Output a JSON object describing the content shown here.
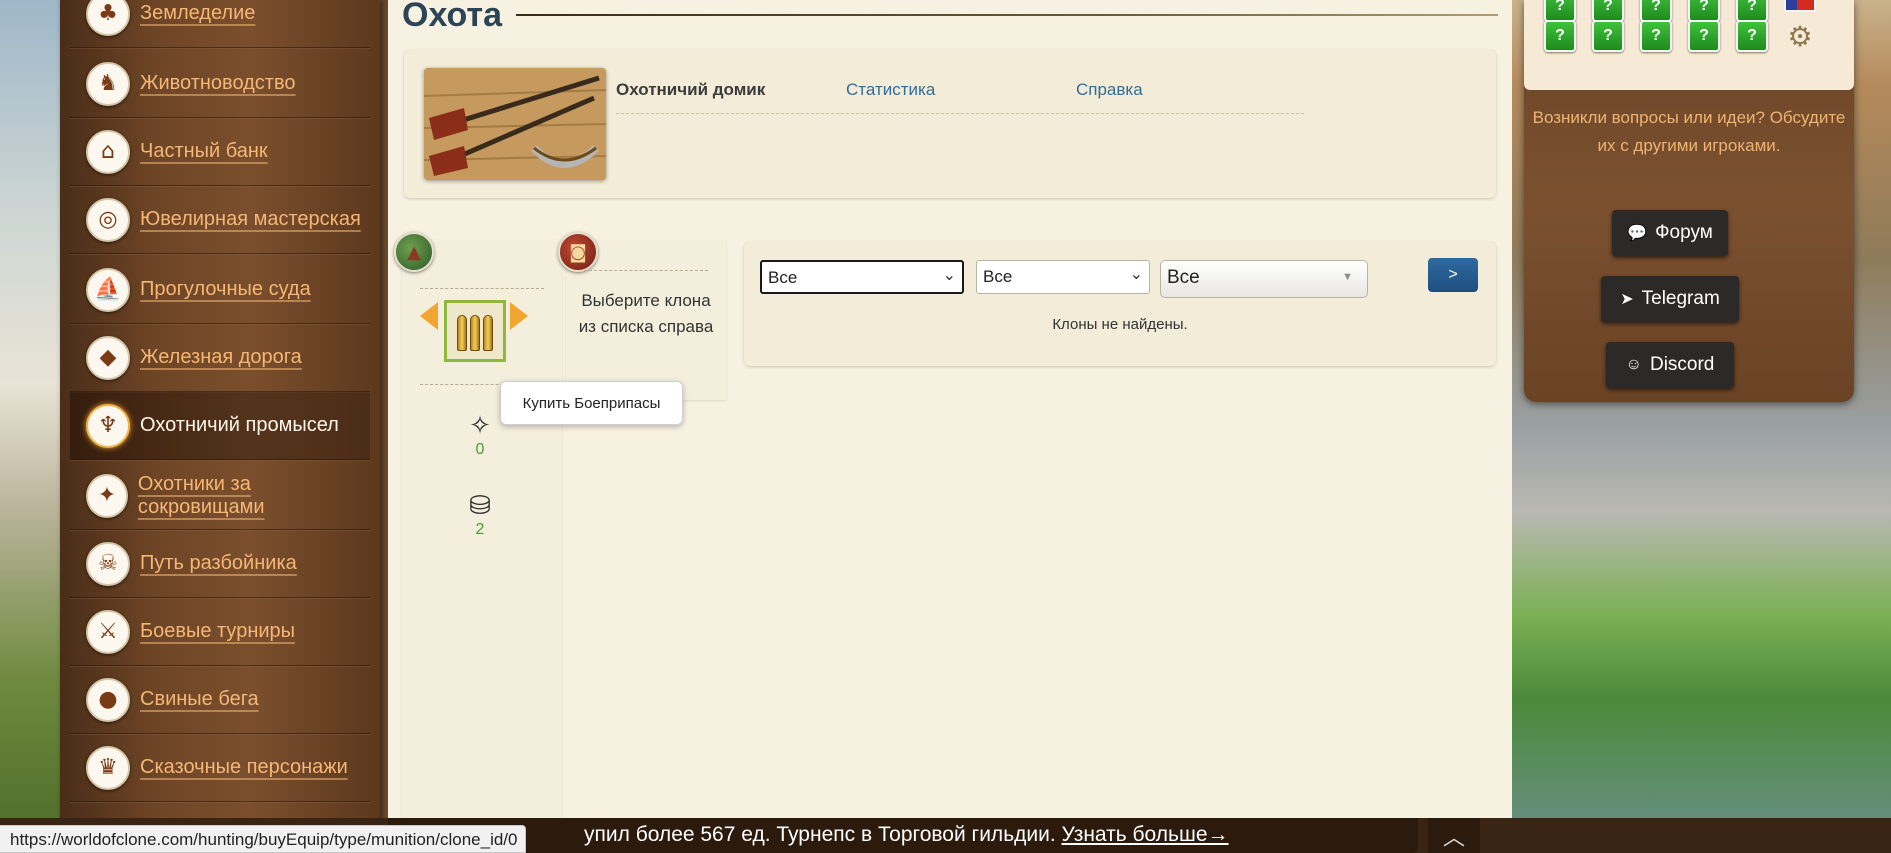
{
  "sidebar": {
    "items": [
      {
        "label": "Земледелие",
        "icon": "farming-icon",
        "glyph": "♣",
        "active": false
      },
      {
        "label": "Животноводство",
        "icon": "livestock-icon",
        "glyph": "♞",
        "active": false
      },
      {
        "label": "Частный банк",
        "icon": "bank-icon",
        "glyph": "⌂",
        "active": false
      },
      {
        "label": "Ювелирная мастерская",
        "icon": "ring-icon",
        "glyph": "◎",
        "active": false
      },
      {
        "label": "Прогулочные суда",
        "icon": "ship-icon",
        "glyph": "⛵",
        "active": false
      },
      {
        "label": "Железная дорога",
        "icon": "train-icon",
        "glyph": "◆",
        "active": false
      },
      {
        "label": "Охотничий промысел",
        "icon": "deer-antlers-icon",
        "glyph": "♆",
        "active": true
      },
      {
        "label": "Охотники за сокровищами",
        "icon": "treasure-map-icon",
        "glyph": "✦",
        "active": false
      },
      {
        "label": "Путь разбойника",
        "icon": "pirate-icon",
        "glyph": "☠",
        "active": false
      },
      {
        "label": "Боевые турниры",
        "icon": "crossed-swords-icon",
        "glyph": "⚔",
        "active": false
      },
      {
        "label": "Свиные бега",
        "icon": "pig-icon",
        "glyph": "●",
        "active": false
      },
      {
        "label": "Сказочные персонажи",
        "icon": "fairy-character-icon",
        "glyph": "♛",
        "active": false
      }
    ]
  },
  "main": {
    "title": "Охота",
    "header": {
      "lodge_label": "Охотничий домик",
      "stats_label": "Статистика",
      "help_label": "Справка"
    },
    "clone_panel": {
      "select_text": "Выберите клона из списка справа",
      "tooltip": "Купить Боеприпасы",
      "resources": [
        {
          "icon": "trap-icon",
          "value": "0"
        },
        {
          "icon": "cauldron-icon",
          "value": "2"
        }
      ]
    },
    "filters": {
      "select1": "Все",
      "select2": "Все",
      "select3": "Все",
      "go_label": ">",
      "empty_message": "Клоны не найдены."
    }
  },
  "right_panel": {
    "question": "Возникли вопросы или идеи? Обсудите их с другими игроками.",
    "forum_label": "Форум",
    "telegram_label": "Telegram",
    "discord_label": "Discord",
    "quest_mark": "?"
  },
  "ticker": {
    "text": "упил более 567 ед. Турнепс в Торговой гильдии.",
    "link": "Узнать больше→"
  },
  "status_url": "https://worldofclone.com/hunting/buyEquip/type/munition/clone_id/0",
  "colors": {
    "sidebar_link": "#f4b775",
    "title": "#2b4456",
    "link_blue": "#2f6e9b",
    "go_button": "#1e4f7f",
    "count_green": "#4d9a35"
  }
}
